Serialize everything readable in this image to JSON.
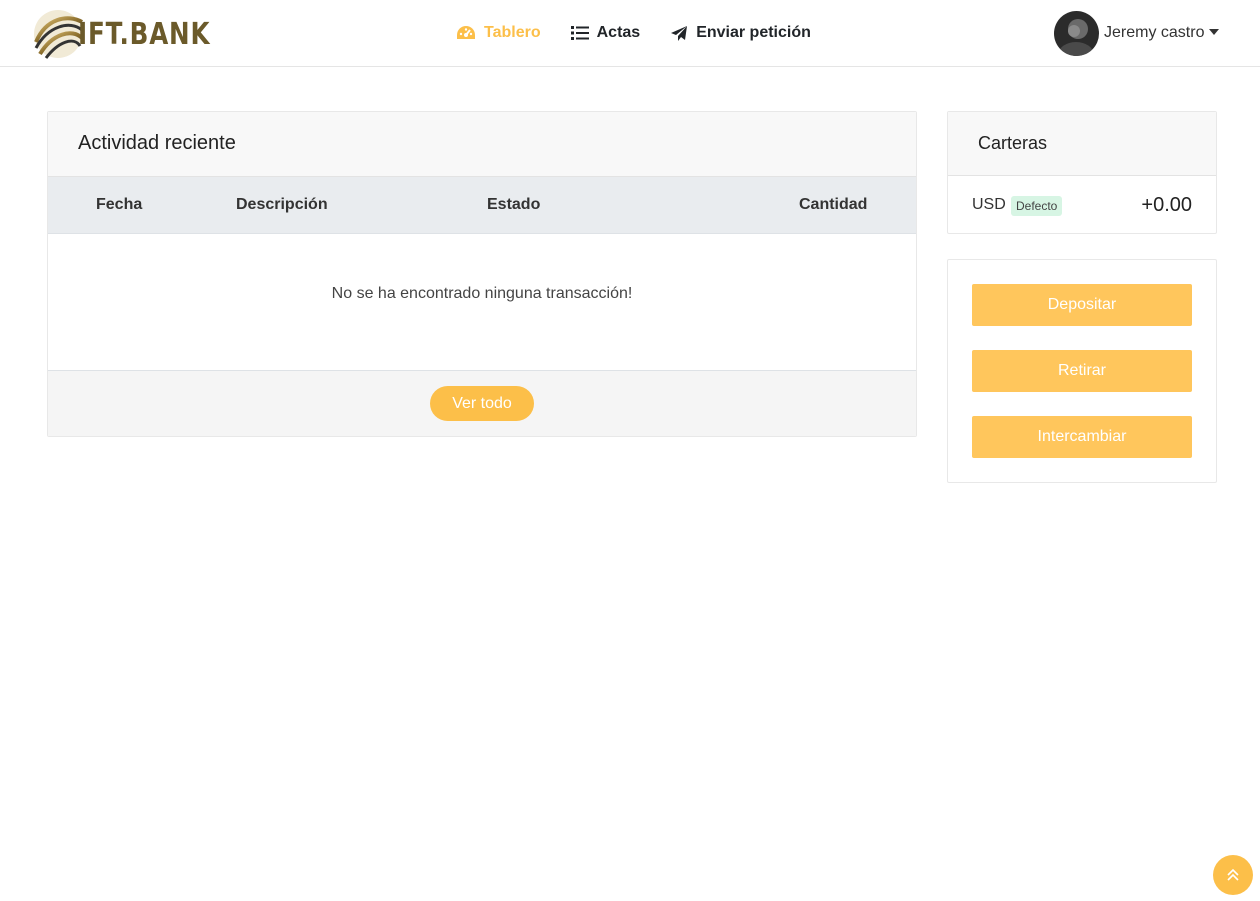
{
  "header": {
    "logo_text": "IFT.BANK",
    "nav": [
      {
        "label": "Tablero",
        "icon": "dashboard-icon",
        "active": true
      },
      {
        "label": "Actas",
        "icon": "list-icon",
        "active": false
      },
      {
        "label": "Enviar petición",
        "icon": "paper-plane-icon",
        "active": false
      }
    ],
    "user_name": "Jeremy castro"
  },
  "activity": {
    "title": "Actividad reciente",
    "columns": [
      "Fecha",
      "Descripción",
      "Estado",
      "Cantidad"
    ],
    "empty_message": "No se ha encontrado ninguna transacción!",
    "view_all_label": "Ver todo"
  },
  "wallets": {
    "title": "Carteras",
    "items": [
      {
        "currency": "USD",
        "badge": "Defecto",
        "amount": "+0.00"
      }
    ]
  },
  "actions": {
    "deposit_label": "Depositar",
    "withdraw_label": "Retirar",
    "exchange_label": "Intercambiar"
  },
  "colors": {
    "accent": "#fcbf49",
    "button": "#ffc65c",
    "badge_bg": "#d7f5e4"
  }
}
